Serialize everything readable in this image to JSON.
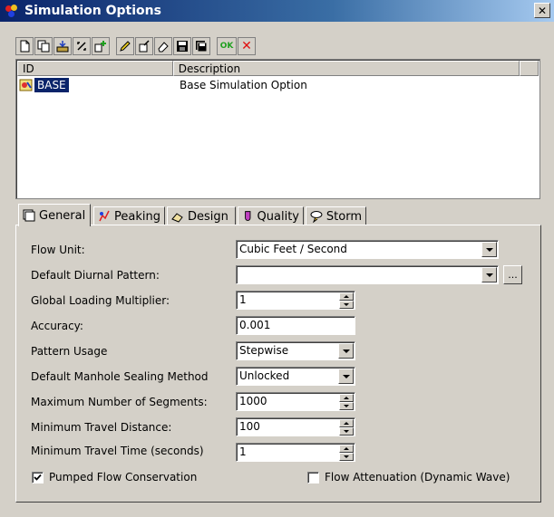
{
  "window": {
    "title": "Simulation Options",
    "close_label": "✕"
  },
  "toolbar": {
    "buttons": [
      "new-icon",
      "duplicate-icon",
      "import-icon",
      "edit-link-icon",
      "add-icon",
      "pencil-icon",
      "rename-icon",
      "eraser-icon",
      "save-icon",
      "save-all-icon"
    ],
    "ok_label": "OK",
    "cancel_label": "✕"
  },
  "list": {
    "columns": [
      "ID",
      "Description"
    ],
    "rows": [
      {
        "id": "BASE",
        "description": "Base Simulation Option"
      }
    ]
  },
  "tabs": [
    {
      "label": "General",
      "icon": "general-icon",
      "active": true
    },
    {
      "label": "Peaking",
      "icon": "peaking-icon",
      "active": false
    },
    {
      "label": "Design",
      "icon": "design-icon",
      "active": false
    },
    {
      "label": "Quality",
      "icon": "quality-icon",
      "active": false
    },
    {
      "label": "Storm",
      "icon": "storm-icon",
      "active": false
    }
  ],
  "general": {
    "flow_unit": {
      "label": "Flow Unit:",
      "value": "Cubic Feet / Second"
    },
    "diurnal_pattern": {
      "label": "Default Diurnal Pattern:",
      "value": "",
      "button_label": "..."
    },
    "loading_multiplier": {
      "label": "Global Loading Multiplier:",
      "value": "1"
    },
    "accuracy": {
      "label": "Accuracy:",
      "value": "0.001"
    },
    "pattern_usage": {
      "label": "Pattern Usage",
      "value": "Stepwise"
    },
    "sealing_method": {
      "label": "Default Manhole Sealing Method",
      "value": "Unlocked"
    },
    "max_segments": {
      "label": "Maximum Number of Segments:",
      "value": "1000"
    },
    "min_travel_distance": {
      "label": "Minimum Travel Distance:",
      "value": "100"
    },
    "min_travel_time": {
      "label": "Minimum Travel Time (seconds)",
      "value": "1"
    },
    "pumped_flow": {
      "label": "Pumped Flow Conservation",
      "checked": true
    },
    "flow_attenuation": {
      "label": "Flow Attenuation (Dynamic Wave)",
      "checked": false
    }
  },
  "colors": {
    "face": "#d4d0c8",
    "title_start": "#0a246a",
    "title_end": "#a6caf0",
    "selection": "#0a246a",
    "ok_green": "#20a020",
    "cancel_red": "#e01010"
  }
}
